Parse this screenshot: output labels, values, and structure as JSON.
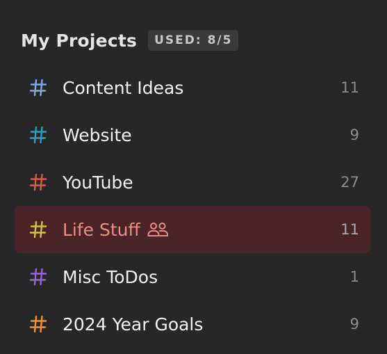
{
  "header": {
    "title": "My Projects",
    "usage_badge": "USED: 8/5"
  },
  "projects": [
    {
      "name": "Content Ideas",
      "count": "11",
      "hash_color": "#7fa7e0",
      "icon": "hash-icon"
    },
    {
      "name": "Website",
      "count": "9",
      "hash_color": "#2aa1b6",
      "icon": "hash-icon"
    },
    {
      "name": "YouTube",
      "count": "27",
      "hash_color": "#e0564c",
      "icon": "hash-icon"
    },
    {
      "name": "Life Stuff",
      "count": "11",
      "hash_color": "#d4c13d",
      "icon": "hash-icon",
      "selected": true,
      "shared": true,
      "shared_icon": "people-icon"
    },
    {
      "name": "Misc ToDos",
      "count": "1",
      "hash_color": "#9b63d8",
      "icon": "hash-icon"
    },
    {
      "name": "2024 Year Goals",
      "count": "9",
      "hash_color": "#f2922e",
      "icon": "hash-icon"
    }
  ],
  "colors": {
    "background": "#272727",
    "selected_background": "#4a2527",
    "selected_text": "#f08a84"
  }
}
